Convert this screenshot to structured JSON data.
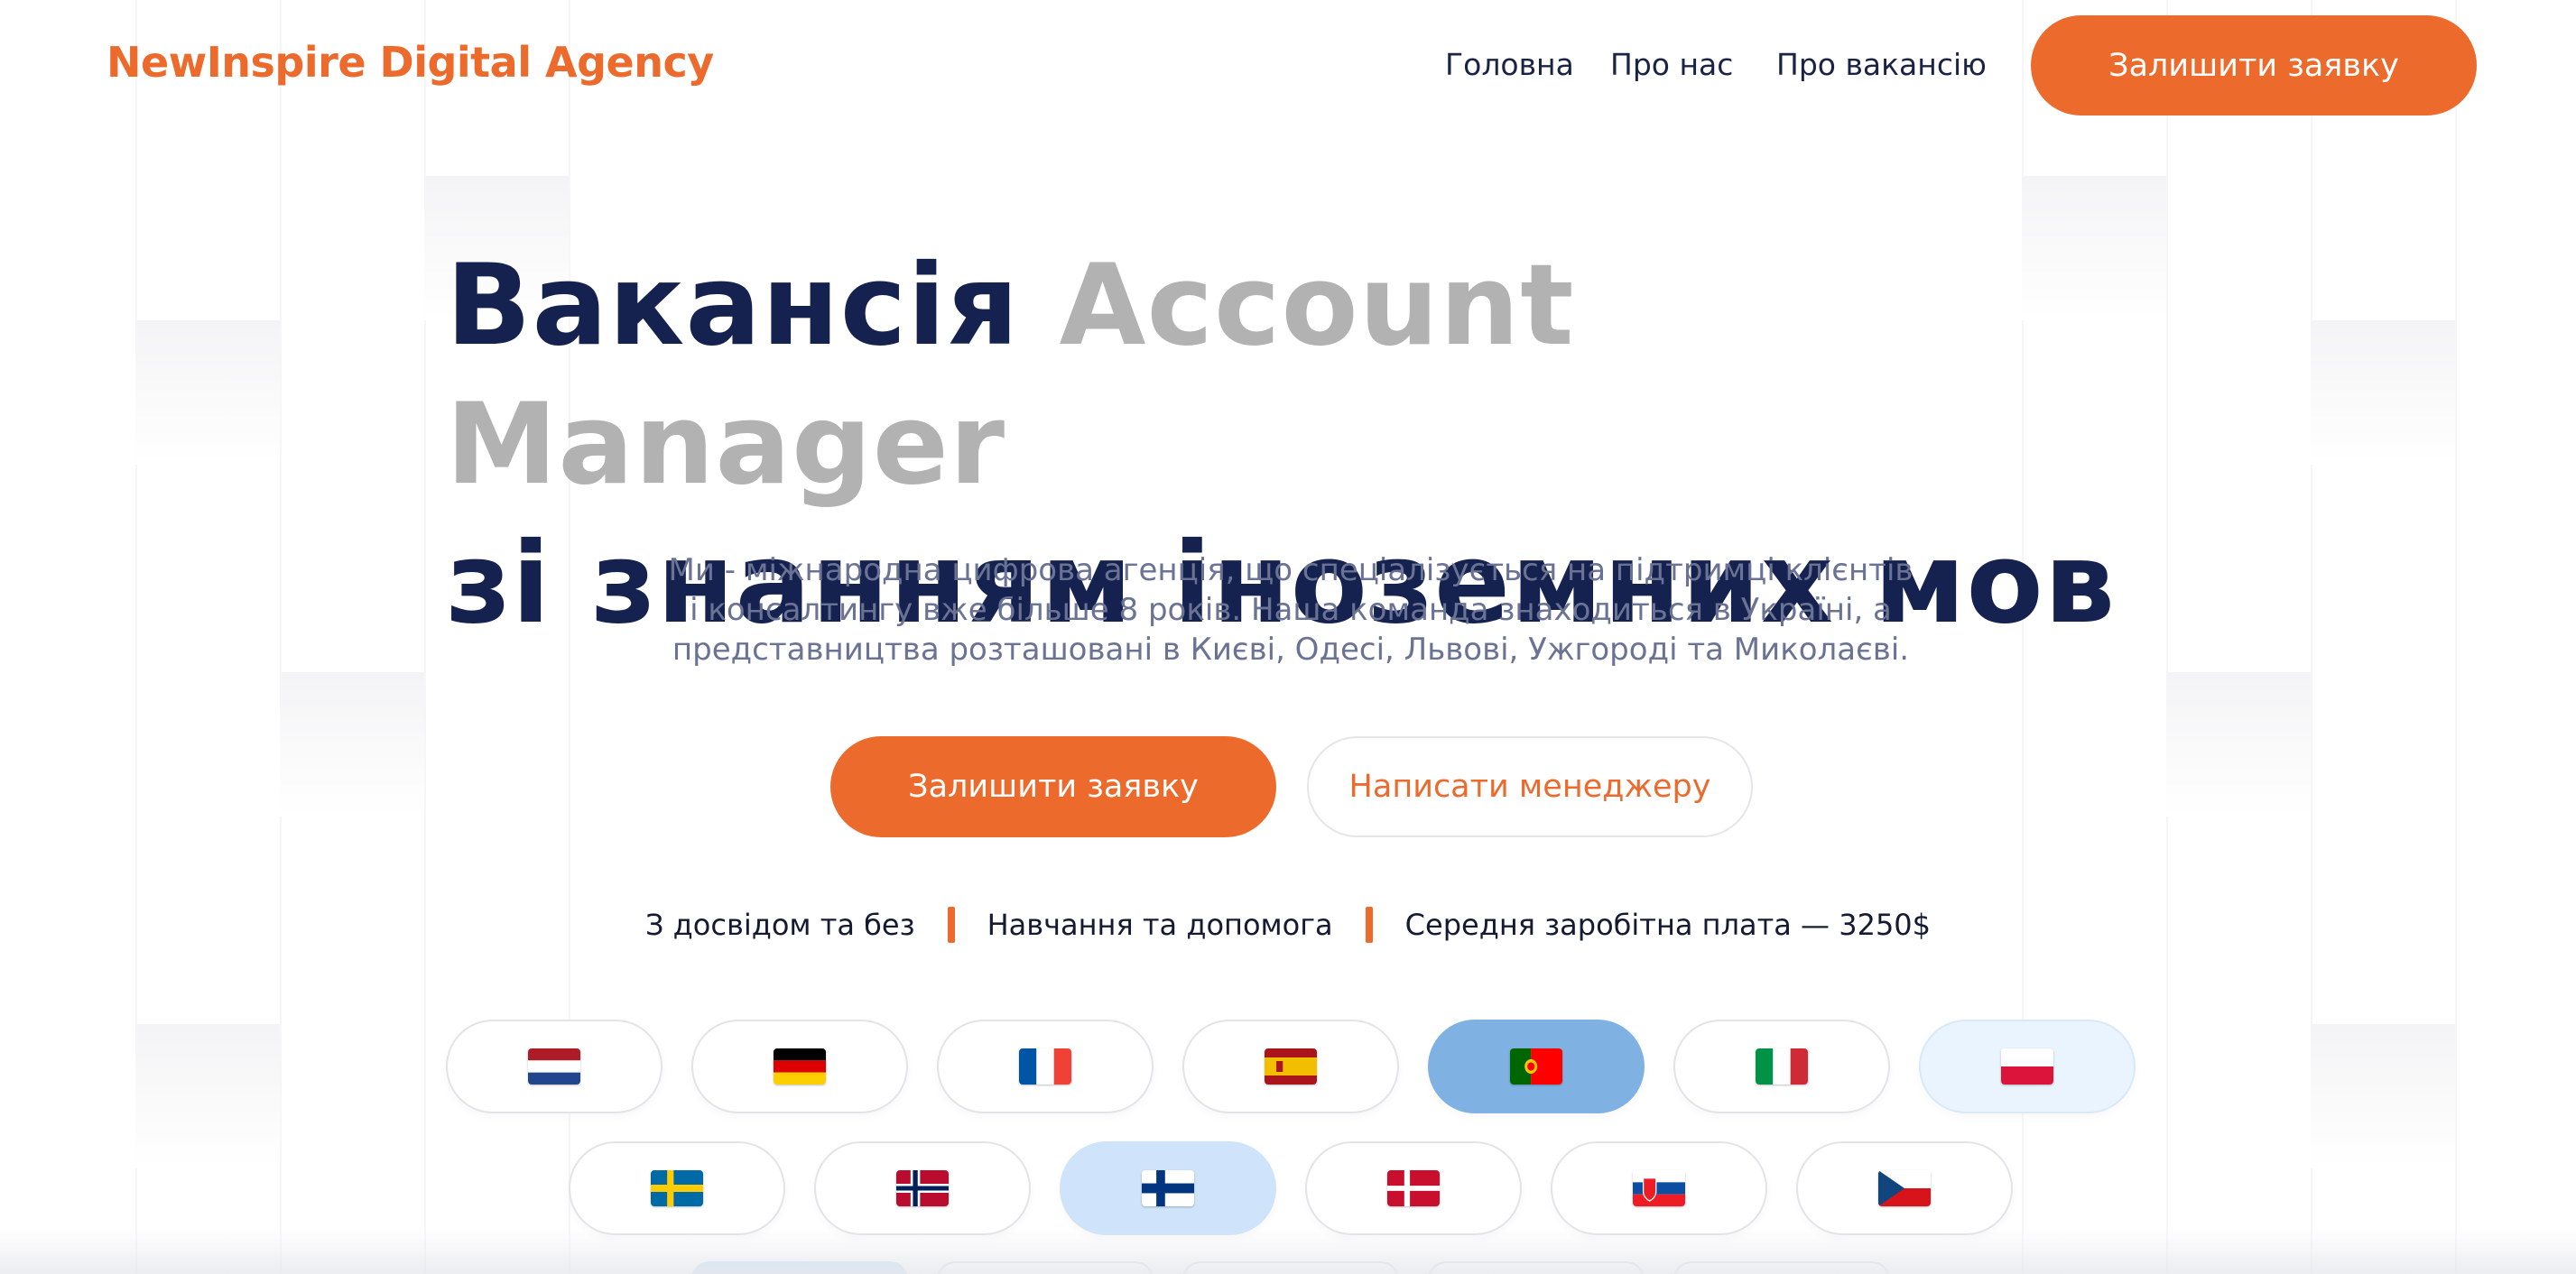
{
  "header": {
    "logo": "NewInspire Digital Agency",
    "nav": [
      "Головна",
      "Про нас",
      "Про вакансію"
    ],
    "cta": "Залишити заявку"
  },
  "hero": {
    "title_part1": "Вакансія",
    "title_accent": "Account Manager",
    "title_part2": "зі знанням іноземних мов",
    "description_lines": [
      "Ми - міжнародна цифрова агенція, що спеціалізується на підтримці клієнтів",
      "і консалтингу вже більше 8 років. Наша команда знаходиться в Україні, а",
      "представництва розташовані в Києві, Одесі, Львові, Ужгороді та Миколаєві."
    ],
    "primary_button": "Залишити заявку",
    "secondary_button": "Написати менеджеру"
  },
  "features": [
    "З досвідом та без",
    "Навчання та допомога",
    "Середня заробітна плата — 3250$"
  ],
  "flags": {
    "row1": [
      {
        "icon": "netherlands-flag-icon",
        "state": "default"
      },
      {
        "icon": "germany-flag-icon",
        "state": "default"
      },
      {
        "icon": "france-flag-icon",
        "state": "default"
      },
      {
        "icon": "spain-flag-icon",
        "state": "default"
      },
      {
        "icon": "portugal-flag-icon",
        "state": "active"
      },
      {
        "icon": "italy-flag-icon",
        "state": "default"
      },
      {
        "icon": "poland-flag-icon",
        "state": "hover"
      }
    ],
    "row2": [
      {
        "icon": "sweden-flag-icon",
        "state": "default"
      },
      {
        "icon": "norway-flag-icon",
        "state": "default"
      },
      {
        "icon": "finland-flag-icon",
        "state": "selected-light"
      },
      {
        "icon": "denmark-flag-icon",
        "state": "default"
      },
      {
        "icon": "slovakia-flag-icon",
        "state": "default"
      },
      {
        "icon": "czech-flag-icon",
        "state": "default"
      }
    ]
  },
  "colors": {
    "accent": "#ec6a2c",
    "title": "#15224f",
    "title_accent": "#b2b2b2",
    "body_text": "#6b7394",
    "active_pill": "#7fb2e2"
  }
}
